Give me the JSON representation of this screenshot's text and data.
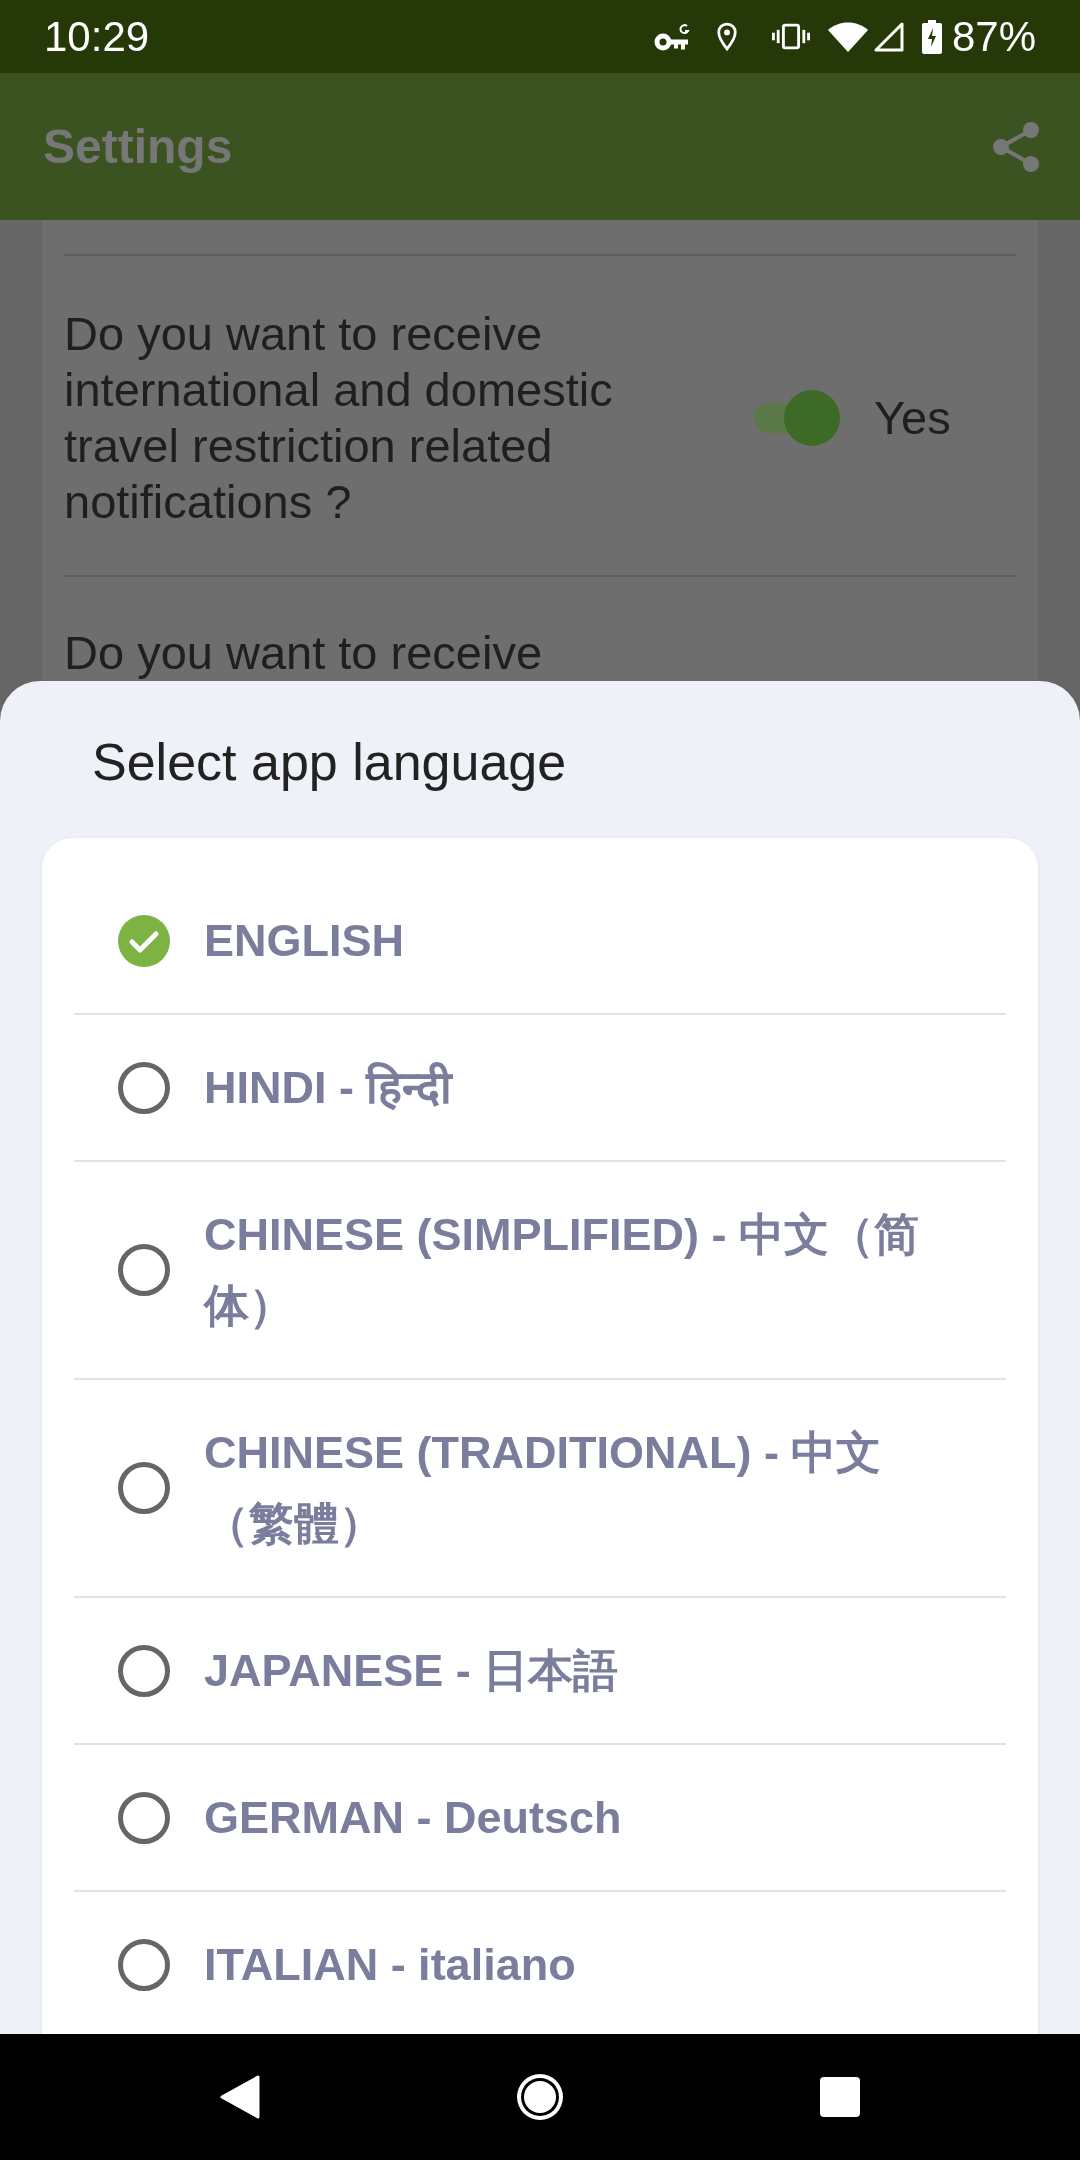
{
  "status_bar": {
    "time": "10:29",
    "battery": "87%"
  },
  "app_bar": {
    "title": "Settings"
  },
  "settings": {
    "items": [
      {
        "question": "Do you want to receive international and domestic travel restriction related notifications ?",
        "on": true,
        "value": "Yes"
      },
      {
        "question": "Do you want to receive"
      }
    ]
  },
  "language_sheet": {
    "title": "Select app language",
    "options": [
      {
        "label": "ENGLISH",
        "selected": true
      },
      {
        "label": "HINDI - हिन्दी",
        "selected": false
      },
      {
        "label": "CHINESE (SIMPLIFIED) - 中文（简体）",
        "selected": false
      },
      {
        "label": "CHINESE (TRADITIONAL) - 中文（繁體）",
        "selected": false
      },
      {
        "label": "JAPANESE - 日本語",
        "selected": false
      },
      {
        "label": "GERMAN - Deutsch",
        "selected": false
      },
      {
        "label": "ITALIAN - italiano",
        "selected": false
      }
    ]
  }
}
